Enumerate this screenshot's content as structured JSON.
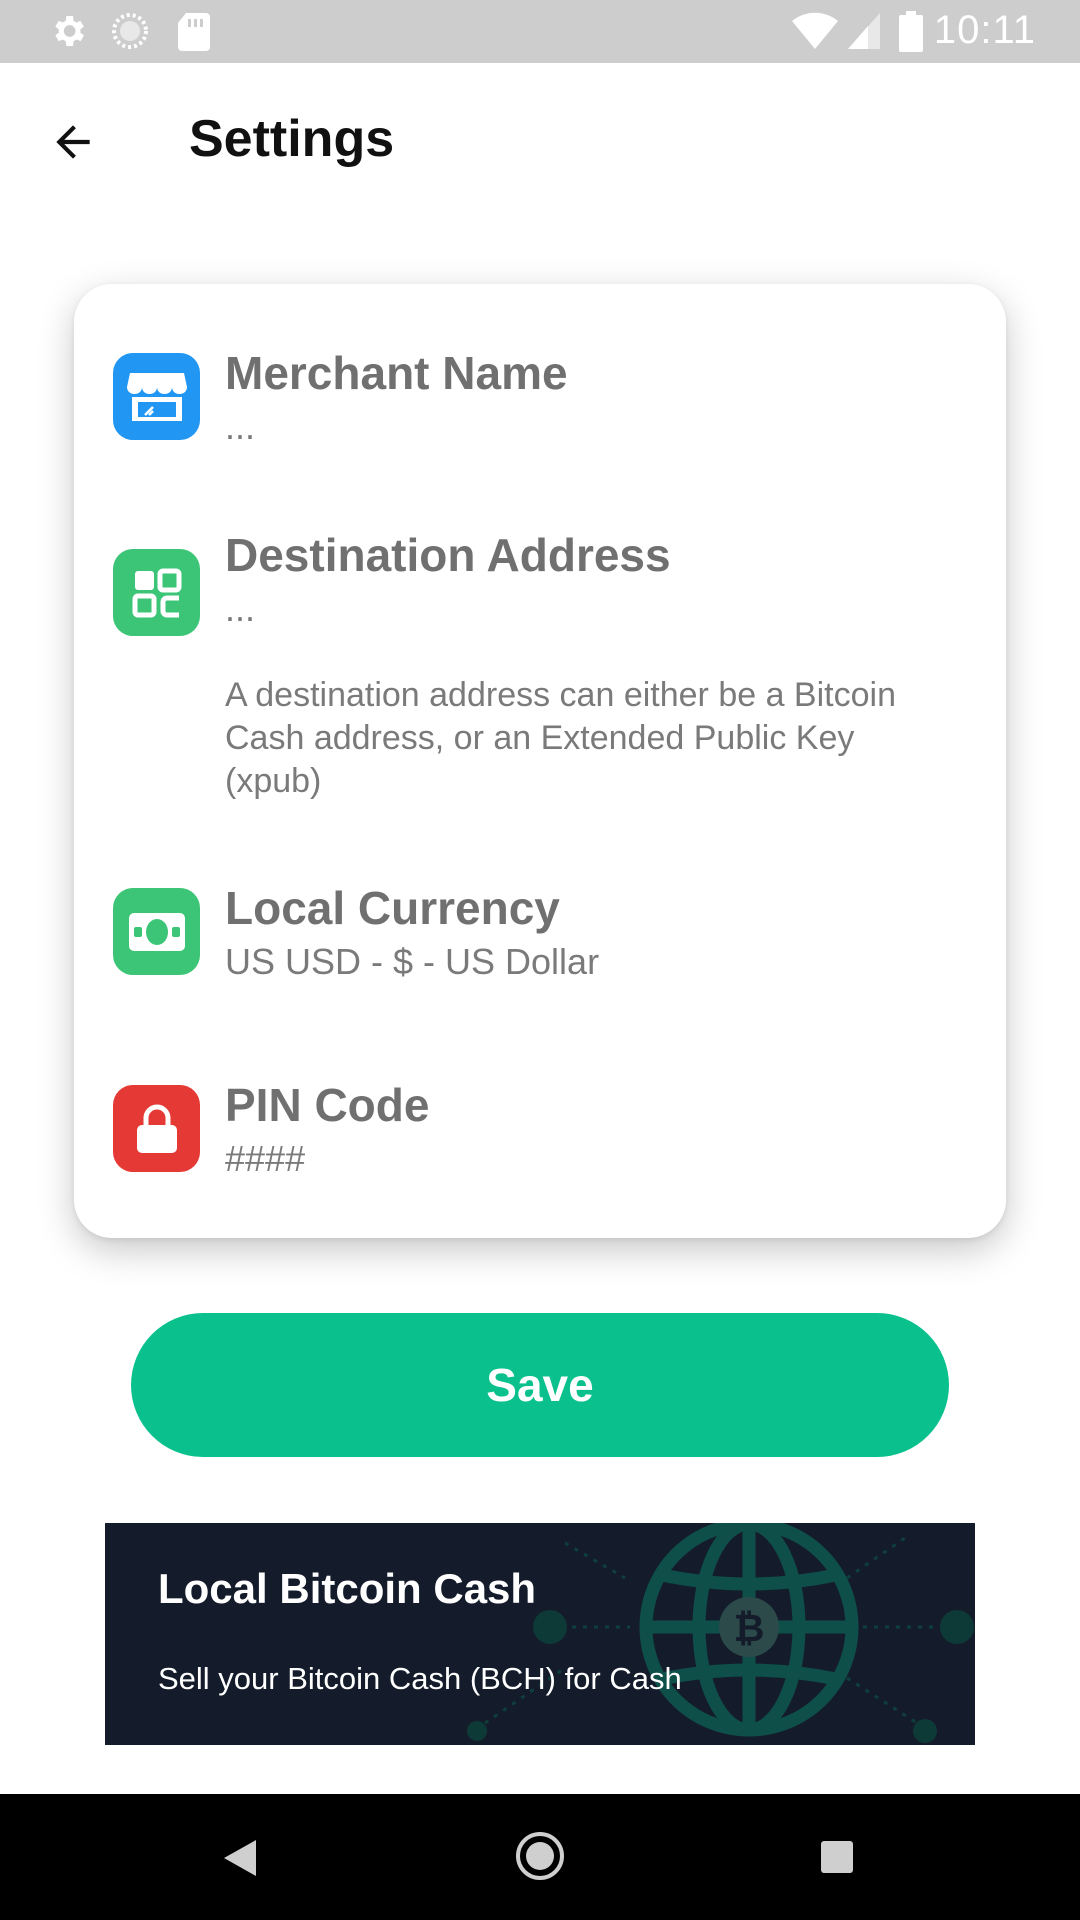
{
  "status_bar": {
    "time": "10:11",
    "left_icons": [
      "gear-icon",
      "loading-icon",
      "sd-card-icon"
    ],
    "right_icons": [
      "wifi-icon",
      "signal-icon",
      "battery-icon"
    ]
  },
  "app_bar": {
    "title": "Settings",
    "back_icon": "arrow-left-icon"
  },
  "settings": {
    "merchant": {
      "title": "Merchant Name",
      "value": "...",
      "icon": "storefront-icon",
      "color": "#2196f3"
    },
    "destination": {
      "title": "Destination Address",
      "value": "...",
      "help": "A destination address can either be a Bitcoin Cash address, or an Extended Public Key (xpub)",
      "icon": "qr-code-icon",
      "color": "#3cc577"
    },
    "currency": {
      "title": "Local Currency",
      "value": "US USD - $ - US Dollar",
      "icon": "banknote-icon",
      "color": "#3cc577"
    },
    "pin": {
      "title": "PIN Code",
      "value": "####",
      "icon": "lock-icon",
      "color": "#e53935"
    }
  },
  "save_label": "Save",
  "banner": {
    "title": "Local Bitcoin Cash",
    "subtitle": "Sell your Bitcoin Cash (BCH) for Cash",
    "art_icon": "globe-bitcoin-icon"
  },
  "nav_bar": {
    "icons": [
      "back-triangle-icon",
      "home-circle-icon",
      "recents-square-icon"
    ]
  },
  "colors": {
    "accent": "#0ac18e",
    "banner_bg": "#141c2b",
    "status_bar": "#cdcdcd"
  }
}
